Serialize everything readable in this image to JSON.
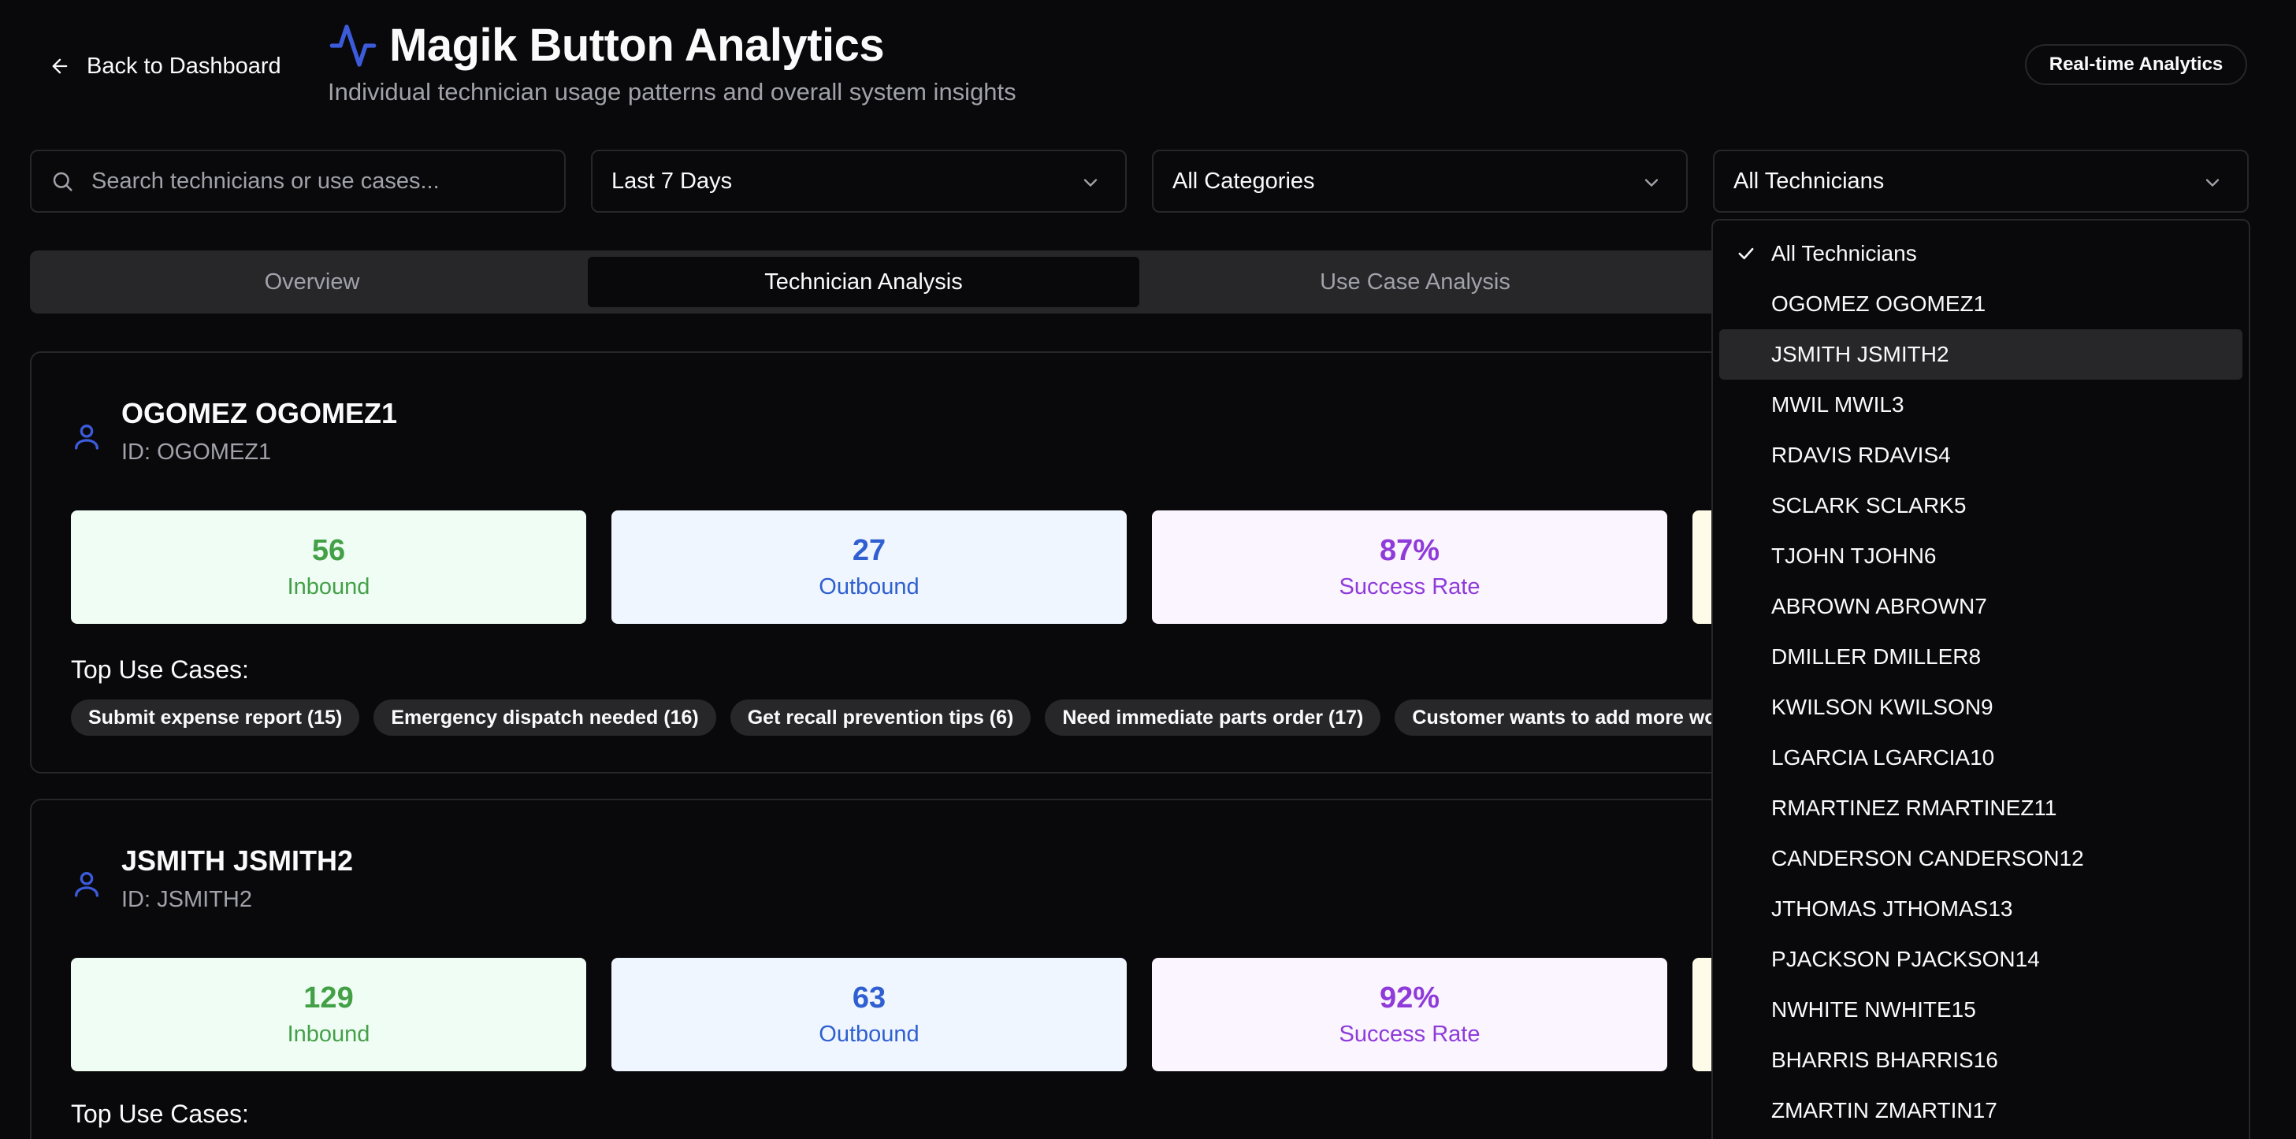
{
  "header": {
    "back_label": "Back to Dashboard",
    "title": "Magik Button Analytics",
    "subtitle": "Individual technician usage patterns and overall system insights",
    "badge": "Real-time Analytics",
    "accent_color": "#3b5bdb"
  },
  "filters": {
    "search_placeholder": "Search technicians or use cases...",
    "date_range": "Last 7 Days",
    "category": "All Categories",
    "technician": "All Technicians"
  },
  "tabs": [
    {
      "label": "Overview",
      "active": false
    },
    {
      "label": "Technician Analysis",
      "active": true
    },
    {
      "label": "Use Case Analysis",
      "active": false
    }
  ],
  "technicians": [
    {
      "name": "OGOMEZ OGOMEZ1",
      "id_label": "ID: OGOMEZ1",
      "inbound": "56",
      "inbound_label": "Inbound",
      "outbound": "27",
      "outbound_label": "Outbound",
      "success": "87%",
      "success_label": "Success Rate",
      "use_cases_title": "Top Use Cases:",
      "use_cases": [
        "Submit expense report (15)",
        "Emergency dispatch needed (16)",
        "Get recall prevention tips (6)",
        "Need immediate parts order (17)",
        "Customer wants to add more wor"
      ]
    },
    {
      "name": "JSMITH JSMITH2",
      "id_label": "ID: JSMITH2",
      "inbound": "129",
      "inbound_label": "Inbound",
      "outbound": "63",
      "outbound_label": "Outbound",
      "success": "92%",
      "success_label": "Success Rate",
      "use_cases_title": "Top Use Cases:"
    }
  ],
  "dropdown": {
    "selected": "All Technicians",
    "highlighted": "JSMITH JSMITH2",
    "options": [
      "All Technicians",
      "OGOMEZ OGOMEZ1",
      "JSMITH JSMITH2",
      "MWIL MWIL3",
      "RDAVIS RDAVIS4",
      "SCLARK SCLARK5",
      "TJOHN TJOHN6",
      "ABROWN ABROWN7",
      "DMILLER DMILLER8",
      "KWILSON KWILSON9",
      "LGARCIA LGARCIA10",
      "RMARTINEZ RMARTINEZ11",
      "CANDERSON CANDERSON12",
      "JTHOMAS JTHOMAS13",
      "PJACKSON PJACKSON14",
      "NWHITE NWHITE15",
      "BHARRIS BHARRIS16",
      "ZMARTIN ZMARTIN17"
    ]
  }
}
